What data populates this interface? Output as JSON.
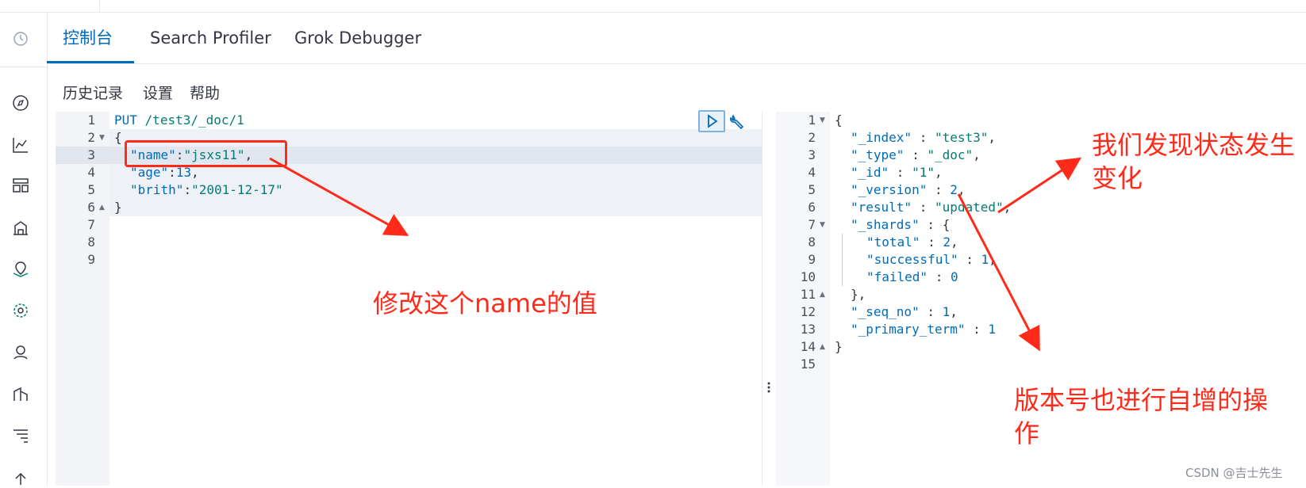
{
  "tabs": [
    {
      "label": "控制台",
      "active": true
    },
    {
      "label": "Search Profiler",
      "active": false
    },
    {
      "label": "Grok Debugger",
      "active": false
    }
  ],
  "toolbar": {
    "history": "历史记录",
    "settings": "设置",
    "help": "帮助"
  },
  "sidebar_icons": [
    "compass-icon",
    "chart-icon",
    "dashboard-icon",
    "canvas-icon",
    "maps-icon",
    "ml-icon",
    "graph-icon",
    "visualize-icon",
    "apm-icon",
    "up-icon"
  ],
  "request": {
    "line_numbers": [
      "1",
      "2",
      "3",
      "4",
      "5",
      "6",
      "7",
      "8",
      "9"
    ],
    "method": "PUT",
    "path": "/test3/_doc/1",
    "open_brace": "{",
    "close_brace": "}",
    "fields": [
      {
        "key": "\"name\"",
        "value": "\"jsxs11\"",
        "trail": ","
      },
      {
        "key": "\"age\"",
        "value": "13",
        "trail": ","
      },
      {
        "key": "\"brith\"",
        "value": "\"2001-12-17\"",
        "trail": ""
      }
    ]
  },
  "response": {
    "line_numbers": [
      "1",
      "2",
      "3",
      "4",
      "5",
      "6",
      "7",
      "8",
      "9",
      "10",
      "11",
      "12",
      "13",
      "14",
      "15"
    ],
    "lines": [
      {
        "k": "",
        "v": "",
        "p": "{"
      },
      {
        "k": "\"_index\"",
        "v": "\"test3\"",
        "p": ","
      },
      {
        "k": "\"_type\"",
        "v": "\"_doc\"",
        "p": ","
      },
      {
        "k": "\"_id\"",
        "v": "\"1\"",
        "p": ","
      },
      {
        "k": "\"_version\"",
        "v": "2",
        "p": ","
      },
      {
        "k": "\"result\"",
        "v": "\"updated\"",
        "p": ","
      },
      {
        "k": "\"_shards\"",
        "v": "{",
        "p": ""
      },
      {
        "k": "\"total\"",
        "v": "2",
        "p": ","
      },
      {
        "k": "\"successful\"",
        "v": "1",
        "p": ","
      },
      {
        "k": "\"failed\"",
        "v": "0",
        "p": ""
      },
      {
        "k": "",
        "v": "",
        "p": "},"
      },
      {
        "k": "\"_seq_no\"",
        "v": "1",
        "p": ","
      },
      {
        "k": "\"_primary_term\"",
        "v": "1",
        "p": ""
      },
      {
        "k": "",
        "v": "",
        "p": "}"
      }
    ]
  },
  "annotations": {
    "modify": "修改这个name的值",
    "state_change_1": "我们发现状态发生",
    "state_change_2": "变化",
    "version_1": "版本号也进行自增的操",
    "version_2": "作"
  },
  "watermark": "CSDN @吉士先生",
  "colors": {
    "accent": "#006bb8",
    "annotation": "#ff2a1a",
    "string": "#017d73"
  }
}
